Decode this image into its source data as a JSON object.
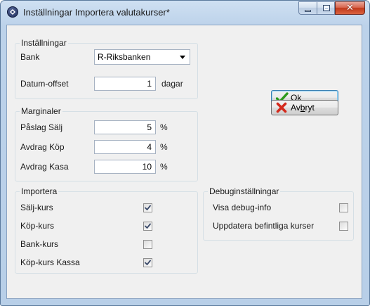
{
  "window": {
    "title": "Inställningar Importera valutakurser*",
    "close_glyph": "✕"
  },
  "installningar": {
    "title": "Inställningar",
    "bank_label": "Bank",
    "bank_value": "R-Riksbanken",
    "datum_label": "Datum-offset",
    "datum_value": "1",
    "datum_unit": "dagar"
  },
  "marginaler": {
    "title": "Marginaler",
    "rows": [
      {
        "label": "Påslag Sälj",
        "value": "5",
        "unit": "%"
      },
      {
        "label": "Avdrag Köp",
        "value": "4",
        "unit": "%"
      },
      {
        "label": "Avdrag Kasa",
        "value": "10",
        "unit": "%"
      }
    ]
  },
  "importera": {
    "title": "Importera",
    "items": [
      {
        "label": "Sälj-kurs",
        "checked": true
      },
      {
        "label": "Köp-kurs",
        "checked": true
      },
      {
        "label": "Bank-kurs",
        "checked": false
      },
      {
        "label": "Köp-kurs Kassa",
        "checked": true
      }
    ]
  },
  "debug": {
    "title": "Debuginställningar",
    "items": [
      {
        "label": "Visa debug-info",
        "checked": false
      },
      {
        "label": "Uppdatera befintliga kurser",
        "checked": false
      }
    ]
  },
  "buttons": {
    "ok": {
      "pre": "",
      "mnemonic": "O",
      "post": "k"
    },
    "cancel": {
      "pre": "Av",
      "mnemonic": "b",
      "post": "ryt"
    }
  },
  "colors": {
    "check_green": "#2a9a1c",
    "cancel_red": "#d42a1c",
    "check_mark": "#3a4a6a"
  }
}
